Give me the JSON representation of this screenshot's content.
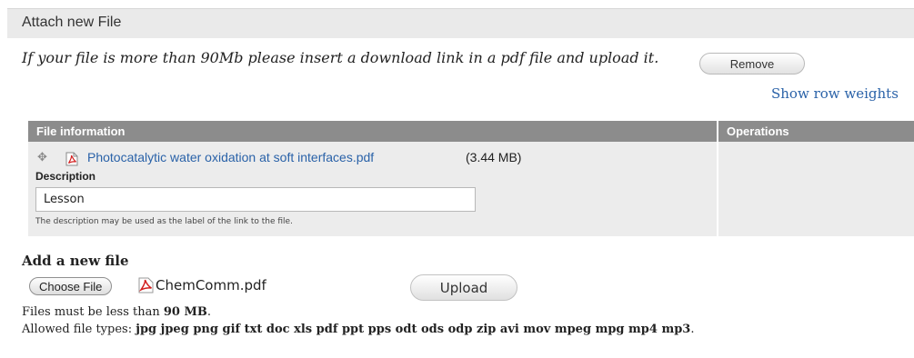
{
  "fieldset": {
    "title": "Attach new File"
  },
  "note": "If your file is more than 90Mb please insert a download link in a pdf file and upload it.",
  "show_row_weights": "Show row weights",
  "table": {
    "headers": [
      "File information",
      "Operations"
    ],
    "rows": [
      {
        "file_name": "Photocatalytic water oxidation at soft interfaces.pdf",
        "file_size": "(3.44 MB)",
        "description_label": "Description",
        "description_value": "Lesson",
        "description_help": "The description may be used as the label of the link to the file.",
        "remove_label": "Remove"
      }
    ]
  },
  "add_new": {
    "title": "Add a new file",
    "choose_label": "Choose File",
    "chosen_file": "ChemComm.pdf",
    "upload_label": "Upload",
    "size_prefix": "Files must be less than ",
    "size_value": "90 MB",
    "size_suffix": ".",
    "types_prefix": "Allowed file types: ",
    "types_value": "jpg jpeg png gif txt doc xls pdf ppt pps odt ods odp zip avi mov mpeg mpg mp4 mp3",
    "types_suffix": "."
  },
  "colors": {
    "link": "#2a62a8",
    "header_bg": "#8c8c8c",
    "row_bg": "#ececec",
    "pdf_red": "#d21f1f"
  },
  "icons": [
    "drag-handle-icon",
    "pdf-file-icon"
  ]
}
